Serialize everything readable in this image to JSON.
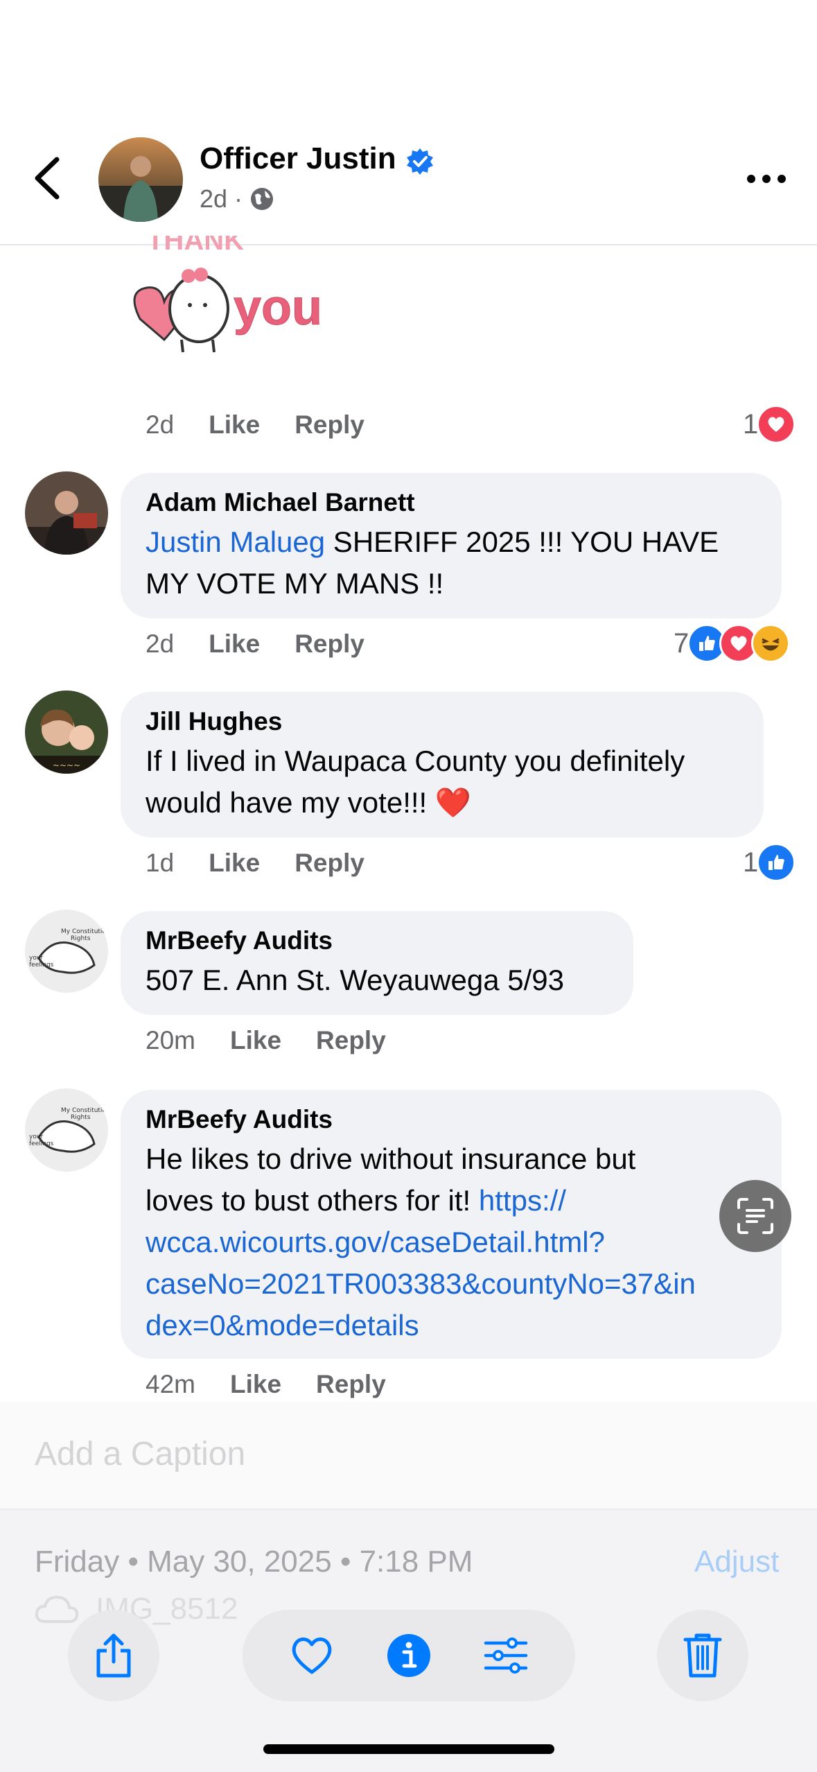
{
  "header": {
    "name": "Officer Justin",
    "time": "2d",
    "dot": "·"
  },
  "first_comment": {
    "time": "2d",
    "like": "Like",
    "reply": "Reply",
    "reactions": "1",
    "sticker_text": "you"
  },
  "comments": [
    {
      "author": "Adam Michael Barnett",
      "mention": "Justin Malueg",
      "text_line1": " SHERIFF 2025 !!! YOU HAVE",
      "text_line2": "MY VOTE MY MANS !!",
      "time": "2d",
      "like": "Like",
      "reply": "Reply",
      "reactions": "7"
    },
    {
      "author": "Jill Hughes",
      "text_line1": "If I lived in Waupaca County you definitely",
      "text_line2": "would have my vote!!! ❤️",
      "time": "1d",
      "like": "Like",
      "reply": "Reply",
      "reactions": "1"
    },
    {
      "author": "MrBeefy Audits",
      "text_line1": "507 E. Ann St. Weyauwega  5/93",
      "time": "20m",
      "like": "Like",
      "reply": "Reply"
    },
    {
      "author": "MrBeefy Audits",
      "text_line1": "He likes to drive without insurance but",
      "text_line2": "loves to bust others for it!  ",
      "link1": "https://",
      "link2": "wcca.wicourts.gov/caseDetail.html?",
      "link3": "caseNo=2021TR003383&countyNo=37&in",
      "link4": "dex=0&mode=details",
      "time": "42m",
      "like": "Like",
      "reply": "Reply"
    }
  ],
  "photos": {
    "caption_placeholder": "Add a Caption",
    "date": "Friday • May 30, 2025 • 7:18 PM",
    "adjust": "Adjust",
    "filename": "IMG_8512"
  },
  "icons": {
    "back": "chevron-left-icon",
    "verified": "verified-badge-icon",
    "globe": "globe-icon",
    "more": "ellipsis-icon",
    "share": "share-icon",
    "favorite": "heart-icon",
    "info": "info-icon",
    "adjust": "sliders-icon",
    "delete": "trash-icon",
    "live_text": "live-text-icon"
  },
  "colors": {
    "link": "#1a66d2",
    "like_blue": "#1877f2",
    "love_red": "#f33e58",
    "ios_blue": "#007aff"
  }
}
